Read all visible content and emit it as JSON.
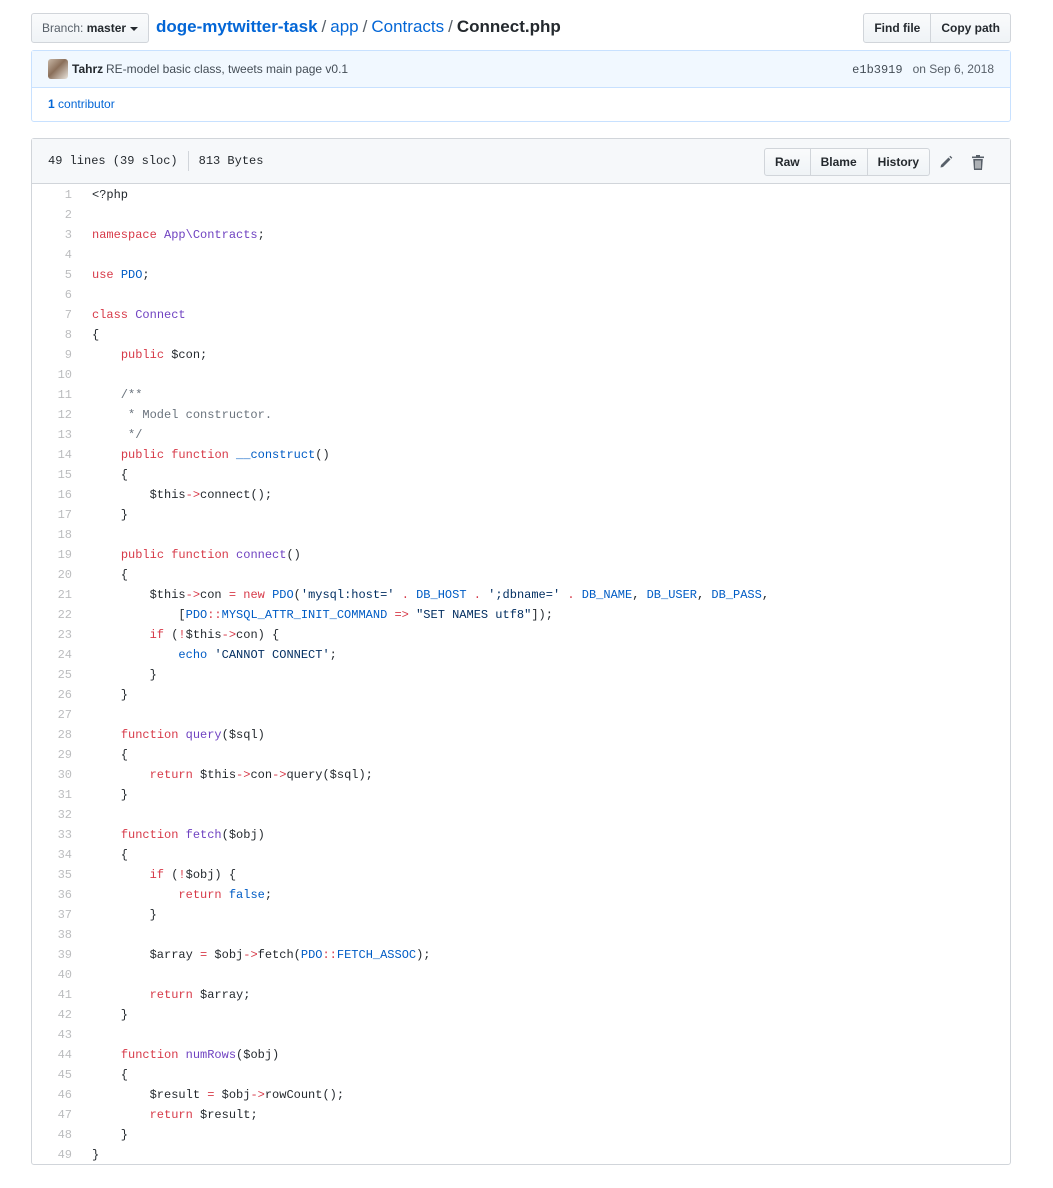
{
  "branch": {
    "prefix": "Branch:",
    "name": "master"
  },
  "breadcrumb": {
    "repo": "doge-mytwitter-task",
    "sep": "/",
    "part1": "app",
    "part2": "Contracts",
    "file": "Connect.php"
  },
  "actions": {
    "find_file": "Find file",
    "copy_path": "Copy path"
  },
  "commit": {
    "author": "Tahrz",
    "message": "RE-model basic class, tweets main page v0.1",
    "sha": "e1b3919",
    "date": "on Sep 6, 2018"
  },
  "contributors": {
    "count": "1",
    "label": "contributor"
  },
  "file": {
    "lines_info": "49 lines (39 sloc)",
    "size": "813 Bytes",
    "raw": "Raw",
    "blame": "Blame",
    "history": "History",
    "edit_icon": "pencil-icon",
    "delete_icon": "trash-icon"
  },
  "code": [
    [
      [
        "",
        "<?php"
      ]
    ],
    [],
    [
      [
        "kw",
        "namespace"
      ],
      [
        "",
        " "
      ],
      [
        "fn",
        "App\\Contracts"
      ],
      [
        "",
        ";"
      ]
    ],
    [],
    [
      [
        "kw",
        "use"
      ],
      [
        "",
        " "
      ],
      [
        "cn",
        "PDO"
      ],
      [
        "",
        ";"
      ]
    ],
    [],
    [
      [
        "kw",
        "class"
      ],
      [
        "",
        " "
      ],
      [
        "fn",
        "Connect"
      ]
    ],
    [
      [
        "",
        "{"
      ]
    ],
    [
      [
        "",
        "    "
      ],
      [
        "kw",
        "public"
      ],
      [
        "",
        " $con;"
      ]
    ],
    [],
    [
      [
        "cm",
        "    /**"
      ]
    ],
    [
      [
        "cm",
        "     * Model constructor."
      ]
    ],
    [
      [
        "cm",
        "     */"
      ]
    ],
    [
      [
        "",
        "    "
      ],
      [
        "kw",
        "public"
      ],
      [
        "",
        " "
      ],
      [
        "kw",
        "function"
      ],
      [
        "",
        " "
      ],
      [
        "cn",
        "__construct"
      ],
      [
        "",
        "()"
      ]
    ],
    [
      [
        "",
        "    {"
      ]
    ],
    [
      [
        "",
        "        $this"
      ],
      [
        "kw",
        "->"
      ],
      [
        "",
        "connect();"
      ]
    ],
    [
      [
        "",
        "    }"
      ]
    ],
    [],
    [
      [
        "",
        "    "
      ],
      [
        "kw",
        "public"
      ],
      [
        "",
        " "
      ],
      [
        "kw",
        "function"
      ],
      [
        "",
        " "
      ],
      [
        "fn",
        "connect"
      ],
      [
        "",
        "()"
      ]
    ],
    [
      [
        "",
        "    {"
      ]
    ],
    [
      [
        "",
        "        $this"
      ],
      [
        "kw",
        "->"
      ],
      [
        "",
        "con "
      ],
      [
        "kw",
        "="
      ],
      [
        "",
        " "
      ],
      [
        "kw",
        "new"
      ],
      [
        "",
        " "
      ],
      [
        "cn",
        "PDO"
      ],
      [
        "",
        "("
      ],
      [
        "st",
        "'mysql:host='"
      ],
      [
        "",
        " "
      ],
      [
        "kw",
        "."
      ],
      [
        "",
        " "
      ],
      [
        "cn",
        "DB_HOST"
      ],
      [
        "",
        " "
      ],
      [
        "kw",
        "."
      ],
      [
        "",
        " "
      ],
      [
        "st",
        "';dbname='"
      ],
      [
        "",
        " "
      ],
      [
        "kw",
        "."
      ],
      [
        "",
        " "
      ],
      [
        "cn",
        "DB_NAME"
      ],
      [
        "",
        ", "
      ],
      [
        "cn",
        "DB_USER"
      ],
      [
        "",
        ", "
      ],
      [
        "cn",
        "DB_PASS"
      ],
      [
        "",
        ","
      ]
    ],
    [
      [
        "",
        "            ["
      ],
      [
        "cn",
        "PDO"
      ],
      [
        "kw",
        "::"
      ],
      [
        "cn",
        "MYSQL_ATTR_INIT_COMMAND"
      ],
      [
        "",
        " "
      ],
      [
        "kw",
        "=>"
      ],
      [
        "",
        " "
      ],
      [
        "st",
        "\"SET NAMES utf8\""
      ],
      [
        "",
        "]);"
      ]
    ],
    [
      [
        "",
        "        "
      ],
      [
        "kw",
        "if"
      ],
      [
        "",
        " ("
      ],
      [
        "kw",
        "!"
      ],
      [
        "",
        "$this"
      ],
      [
        "kw",
        "->"
      ],
      [
        "",
        "con) {"
      ]
    ],
    [
      [
        "",
        "            "
      ],
      [
        "cn",
        "echo"
      ],
      [
        "",
        " "
      ],
      [
        "st",
        "'CANNOT CONNECT'"
      ],
      [
        "",
        ";"
      ]
    ],
    [
      [
        "",
        "        }"
      ]
    ],
    [
      [
        "",
        "    }"
      ]
    ],
    [],
    [
      [
        "",
        "    "
      ],
      [
        "kw",
        "function"
      ],
      [
        "",
        " "
      ],
      [
        "fn",
        "query"
      ],
      [
        "",
        "($sql)"
      ]
    ],
    [
      [
        "",
        "    {"
      ]
    ],
    [
      [
        "",
        "        "
      ],
      [
        "kw",
        "return"
      ],
      [
        "",
        " $this"
      ],
      [
        "kw",
        "->"
      ],
      [
        "",
        "con"
      ],
      [
        "kw",
        "->"
      ],
      [
        "",
        "query($sql);"
      ]
    ],
    [
      [
        "",
        "    }"
      ]
    ],
    [],
    [
      [
        "",
        "    "
      ],
      [
        "kw",
        "function"
      ],
      [
        "",
        " "
      ],
      [
        "fn",
        "fetch"
      ],
      [
        "",
        "($obj)"
      ]
    ],
    [
      [
        "",
        "    {"
      ]
    ],
    [
      [
        "",
        "        "
      ],
      [
        "kw",
        "if"
      ],
      [
        "",
        " ("
      ],
      [
        "kw",
        "!"
      ],
      [
        "",
        "$obj) {"
      ]
    ],
    [
      [
        "",
        "            "
      ],
      [
        "kw",
        "return"
      ],
      [
        "",
        " "
      ],
      [
        "cn",
        "false"
      ],
      [
        "",
        ";"
      ]
    ],
    [
      [
        "",
        "        }"
      ]
    ],
    [],
    [
      [
        "",
        "        $array "
      ],
      [
        "kw",
        "="
      ],
      [
        "",
        " $obj"
      ],
      [
        "kw",
        "->"
      ],
      [
        "",
        "fetch("
      ],
      [
        "cn",
        "PDO"
      ],
      [
        "kw",
        "::"
      ],
      [
        "cn",
        "FETCH_ASSOC"
      ],
      [
        "",
        ");"
      ]
    ],
    [],
    [
      [
        "",
        "        "
      ],
      [
        "kw",
        "return"
      ],
      [
        "",
        " $array;"
      ]
    ],
    [
      [
        "",
        "    }"
      ]
    ],
    [],
    [
      [
        "",
        "    "
      ],
      [
        "kw",
        "function"
      ],
      [
        "",
        " "
      ],
      [
        "fn",
        "numRows"
      ],
      [
        "",
        "($obj)"
      ]
    ],
    [
      [
        "",
        "    {"
      ]
    ],
    [
      [
        "",
        "        $result "
      ],
      [
        "kw",
        "="
      ],
      [
        "",
        " $obj"
      ],
      [
        "kw",
        "->"
      ],
      [
        "",
        "rowCount();"
      ]
    ],
    [
      [
        "",
        "        "
      ],
      [
        "kw",
        "return"
      ],
      [
        "",
        " $result;"
      ]
    ],
    [
      [
        "",
        "    }"
      ]
    ],
    [
      [
        "",
        "}"
      ]
    ]
  ]
}
